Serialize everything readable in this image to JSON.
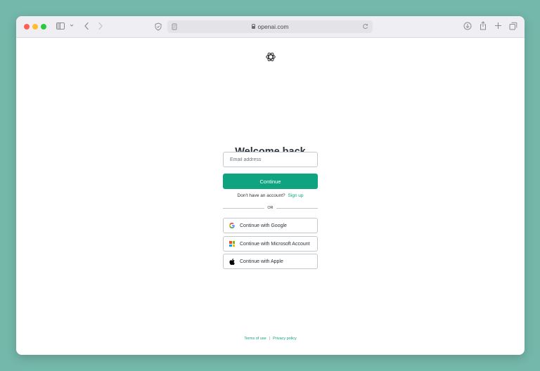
{
  "browser": {
    "url": "openai.com"
  },
  "login": {
    "title": "Welcome back",
    "email_placeholder": "Email address",
    "email_value": "",
    "continue_label": "Continue",
    "no_account_text": "Don't have an account?",
    "signup_label": "Sign up",
    "divider_text": "OR",
    "google_label": "Continue with Google",
    "microsoft_label": "Continue with Microsoft Account",
    "apple_label": "Continue with Apple"
  },
  "footer": {
    "terms_label": "Terms of use",
    "separator": "|",
    "privacy_label": "Privacy policy"
  },
  "icons": {
    "logo": "openai-logo-icon",
    "google": "google-icon",
    "microsoft": "microsoft-icon",
    "apple": "apple-icon"
  },
  "colors": {
    "accent": "#10a37f",
    "background": "#74b8ab",
    "text": "#2d333a",
    "border": "#c2c8d0"
  }
}
